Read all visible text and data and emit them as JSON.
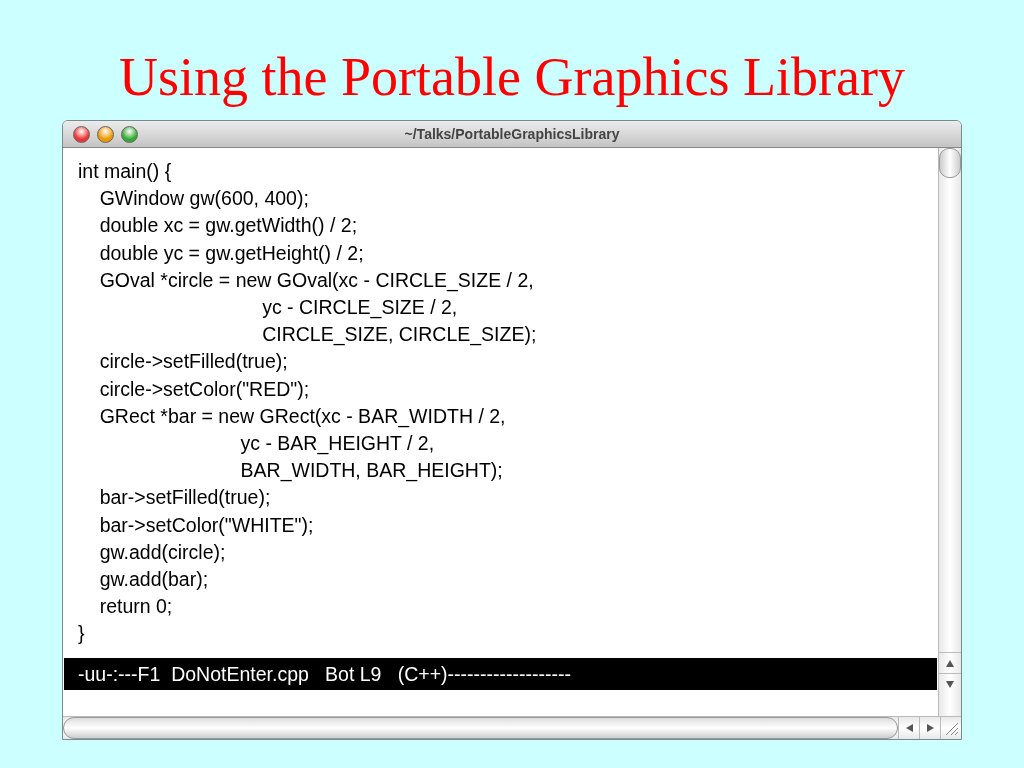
{
  "slide_title": "Using the Portable Graphics Library",
  "window": {
    "title": "~/Talks/PortableGraphicsLibrary"
  },
  "code_lines": [
    "int main() {",
    "    GWindow gw(600, 400);",
    "    double xc = gw.getWidth() / 2;",
    "    double yc = gw.getHeight() / 2;",
    "    GOval *circle = new GOval(xc - CIRCLE_SIZE / 2,",
    "                                  yc - CIRCLE_SIZE / 2,",
    "                                  CIRCLE_SIZE, CIRCLE_SIZE);",
    "    circle->setFilled(true);",
    "    circle->setColor(\"RED\");",
    "    GRect *bar = new GRect(xc - BAR_WIDTH / 2,",
    "                              yc - BAR_HEIGHT / 2,",
    "                              BAR_WIDTH, BAR_HEIGHT);",
    "    bar->setFilled(true);",
    "    bar->setColor(\"WHITE\");",
    "    gw.add(circle);",
    "    gw.add(bar);",
    "    return 0;",
    "}"
  ],
  "mode_line": "-uu-:---F1  DoNotEnter.cpp   Bot L9   (C++)-------------------"
}
